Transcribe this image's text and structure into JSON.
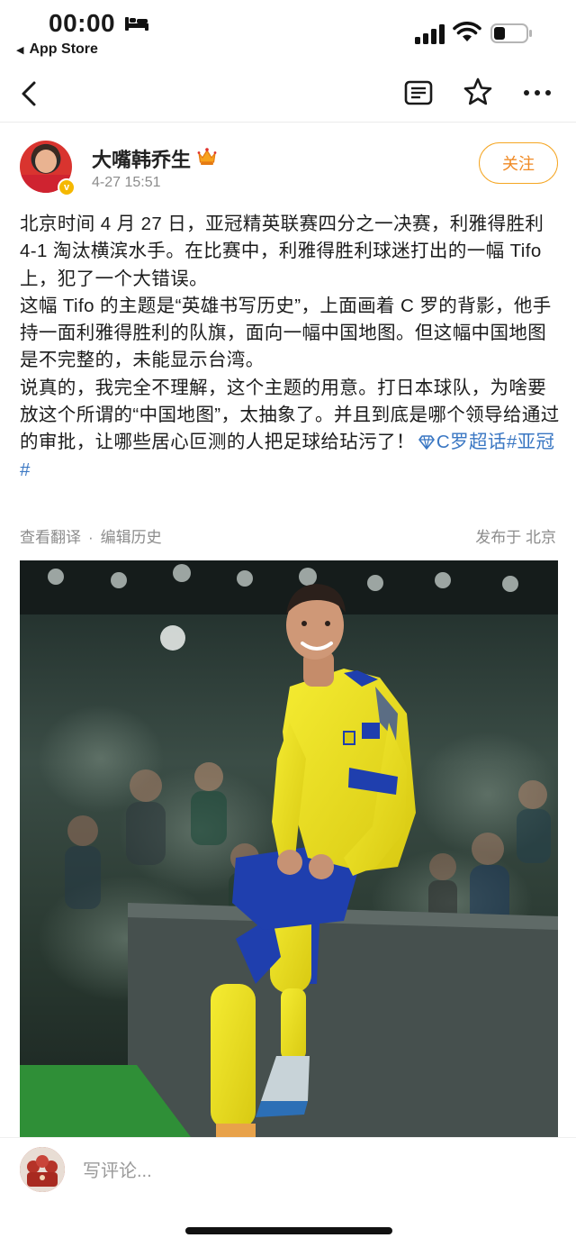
{
  "status_bar": {
    "time": "00:00",
    "back_app": "App Store"
  },
  "nav": {
    "back_icon": "chevron-left-icon",
    "icons": [
      "article-list-icon",
      "star-icon",
      "more-icon"
    ]
  },
  "author": {
    "name": "大嘴韩乔生",
    "time": "4-27 15:51",
    "follow_label": "关注",
    "badge": "v"
  },
  "post": {
    "paragraph1": "北京时间 4 月 27 日，亚冠精英联赛四分之一决赛，利雅得胜利 4-1 淘汰横滨水手。在比赛中，利雅得胜利球迷打出的一幅 Tifo 上，犯了一个大错误。",
    "paragraph2": "这幅 Tifo 的主题是“英雄书写历史”，上面画着 C 罗的背影，他手持一面利雅得胜利的队旗，面向一幅中国地图。但这幅中国地图是不完整的，未能显示台湾。",
    "paragraph3": "说真的，我完全不理解，这个主题的用意。打日本球队，为啥要放这个所谓的“中国地图”，太抽象了。并且到底是哪个领导给通过的审批，让哪些居心叵测的人把足球给玷污了！",
    "topic1": "C罗超话",
    "topic2": "#亚冠#"
  },
  "meta": {
    "translate": "查看翻译",
    "separator": "·",
    "edit_history": "编辑历史",
    "location": "发布于 北京"
  },
  "comment": {
    "placeholder": "写评论..."
  },
  "colors": {
    "accent_orange": "#f08a24",
    "link_blue": "#3a77c3",
    "jersey_yellow": "#f2e21a",
    "shorts_blue": "#1f3fae"
  }
}
